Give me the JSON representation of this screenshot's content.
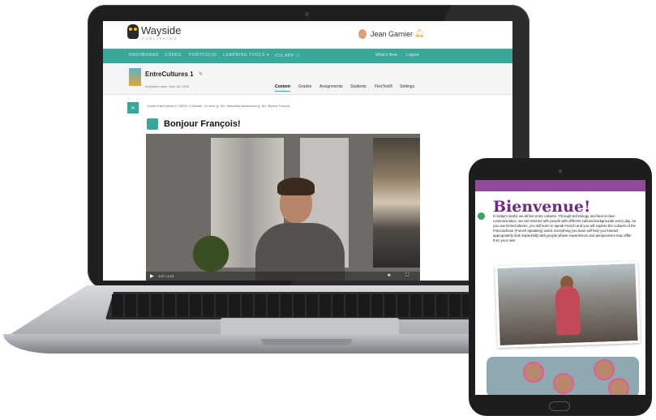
{
  "app": {
    "logo_text": "Wayside",
    "logo_sub": "PUBLISHING",
    "user_name": "Jean Garnier"
  },
  "nav": {
    "items": [
      "DASHBOARD",
      "CODES",
      "PORTFOLIO",
      "LEARNING TOOLS ▾",
      "IOS APP ⓘ"
    ],
    "right": [
      "What's New",
      "Logout"
    ]
  },
  "course": {
    "title": "EntreCultures 1",
    "expiration": "Expiration date: June 30, 2020",
    "tabs": [
      "Content",
      "Grades",
      "Assignments",
      "Students",
      "FlexText®",
      "Settings"
    ]
  },
  "breadcrumb": "Course EntreCultures 1 / UNITÉ 1 L'identité / J'y arrive (p. 80) / Interpretive Assessment (p. 82) / Bonjour François",
  "page": {
    "title": "Bonjour François!",
    "video_time": "1:27 / 1:13"
  },
  "tablet": {
    "heading": "Bienvenue!",
    "body": "In today's world, we all live entre cultures. Through technology and face-to-face communication, we can interact with people with different cultural backgrounds every day. As you use EntreCultures, you will learn to speak French and you will explore the cultures of the Francophone (French-speaking) world. Everything you learn will help you interact appropriately and respectfully with people whose experiences and perspectives may differ from your own."
  },
  "colors": {
    "accent": "#39a89b",
    "tablet_purple": "#6c2b80"
  }
}
